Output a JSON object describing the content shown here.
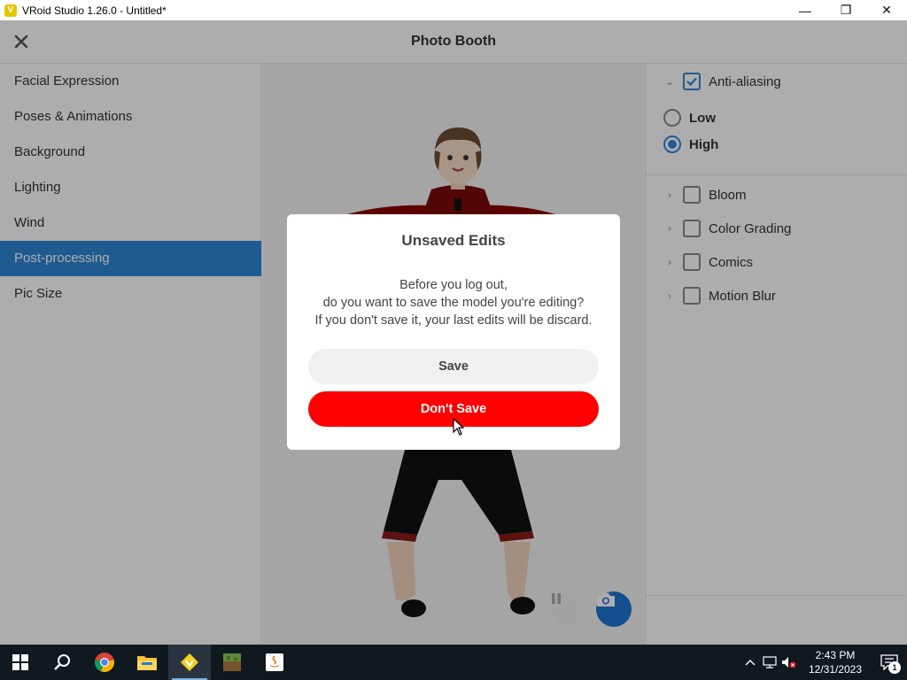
{
  "window": {
    "title": "VRoid Studio 1.26.0 - Untitled*",
    "minimize_glyph": "—",
    "restore_glyph": "❐",
    "close_glyph": "✕"
  },
  "header": {
    "title": "Photo Booth",
    "close_icon": "close-icon"
  },
  "sidebar": {
    "items": [
      {
        "label": "Facial Expression",
        "active": false
      },
      {
        "label": "Poses & Animations",
        "active": false
      },
      {
        "label": "Background",
        "active": false
      },
      {
        "label": "Lighting",
        "active": false
      },
      {
        "label": "Wind",
        "active": false
      },
      {
        "label": "Post-processing",
        "active": true
      },
      {
        "label": "Pic Size",
        "active": false
      }
    ]
  },
  "right_panel": {
    "anti_aliasing": {
      "label": "Anti-aliasing",
      "checked": true,
      "expanded": true
    },
    "quality_options": [
      {
        "label": "Low",
        "selected": false
      },
      {
        "label": "High",
        "selected": true
      }
    ],
    "effects": [
      {
        "label": "Bloom",
        "checked": false
      },
      {
        "label": "Color Grading",
        "checked": false
      },
      {
        "label": "Comics",
        "checked": false
      },
      {
        "label": "Motion Blur",
        "checked": false
      }
    ]
  },
  "dialog": {
    "title": "Unsaved Edits",
    "body_line1": "Before you log out,",
    "body_line2": "do you want to save the model you're editing?",
    "body_line3": "If you don't save it, your last edits will be discard.",
    "save_label": "Save",
    "dont_save_label": "Don't Save"
  },
  "taskbar": {
    "apps": [
      "windows-start-icon",
      "search-icon",
      "chrome-icon",
      "file-explorer-icon",
      "vroid-studio-icon",
      "minecraft-icon",
      "java-icon"
    ],
    "time": "2:43 PM",
    "date": "12/31/2023",
    "notification_count": "1"
  },
  "colors": {
    "accent": "#2f86d6",
    "danger": "#ff0000",
    "camera": "#1e73d2"
  }
}
